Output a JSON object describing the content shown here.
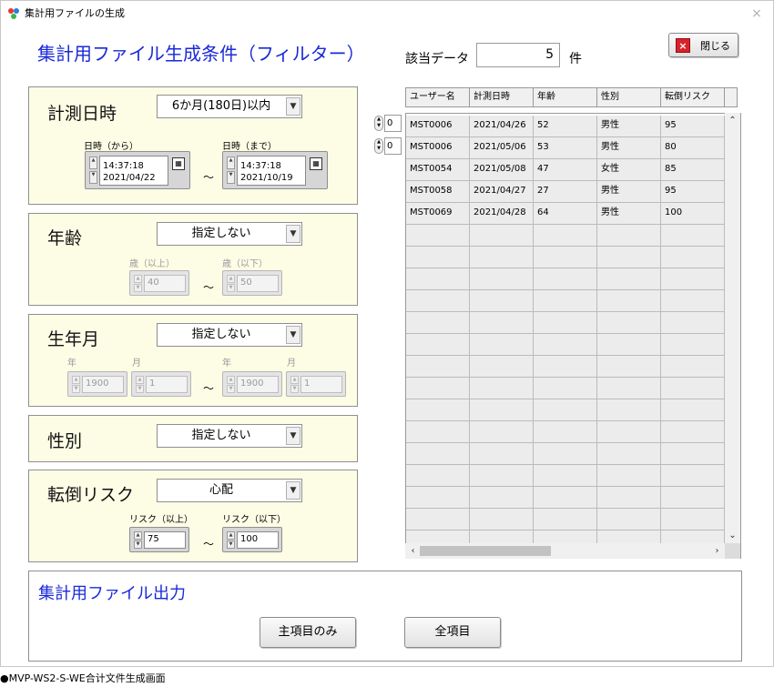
{
  "window": {
    "title": "集計用ファイルの生成",
    "close_glyph": "×"
  },
  "filter_title": "集計用ファイル生成条件（フィルター）",
  "hits": {
    "label": "該当データ",
    "count": "5",
    "unit": "件"
  },
  "close_button": {
    "label": "閉じる",
    "icon_glyph": "×"
  },
  "measure_date": {
    "label": "計測日時",
    "selected": "6か月(180日)以内",
    "from_label": "日時（から）",
    "from_time": "14:37:18",
    "from_date": "2021/04/22",
    "to_label": "日時（まで）",
    "to_time": "14:37:18",
    "to_date": "2021/10/19",
    "tilde": "～"
  },
  "age": {
    "label": "年齢",
    "selected": "指定しない",
    "min_label": "歳（以上）",
    "min_value": "40",
    "max_label": "歳（以下）",
    "max_value": "50",
    "tilde": "～"
  },
  "birth": {
    "label": "生年月",
    "selected": "指定しない",
    "year_label": "年",
    "month_label": "月",
    "from_year": "1900",
    "from_month": "1",
    "to_year": "1900",
    "to_month": "1",
    "tilde": "～"
  },
  "gender": {
    "label": "性別",
    "selected": "指定しない"
  },
  "fall_risk": {
    "label": "転倒リスク",
    "selected": "心配",
    "min_label": "リスク（以上）",
    "min_value": "75",
    "max_label": "リスク（以下）",
    "max_value": "100",
    "tilde": "～"
  },
  "table": {
    "columns": [
      "ユーザー名",
      "計測日時",
      "年齢",
      "性別",
      "転倒リスク"
    ],
    "rows": [
      [
        "MST0006",
        "2021/04/26",
        "52",
        "男性",
        "95"
      ],
      [
        "MST0006",
        "2021/05/06",
        "53",
        "男性",
        "80"
      ],
      [
        "MST0054",
        "2021/05/08",
        "47",
        "女性",
        "85"
      ],
      [
        "MST0058",
        "2021/04/27",
        "27",
        "男性",
        "95"
      ],
      [
        "MST0069",
        "2021/04/28",
        "64",
        "男性",
        "100"
      ]
    ],
    "row_index_top": "0",
    "col_index_left": "0"
  },
  "output": {
    "title": "集計用ファイル出力",
    "main_button": "主項目のみ",
    "all_button": "全項目"
  },
  "caption": "●MVP-WS2-S-WE合计文件生成画面"
}
